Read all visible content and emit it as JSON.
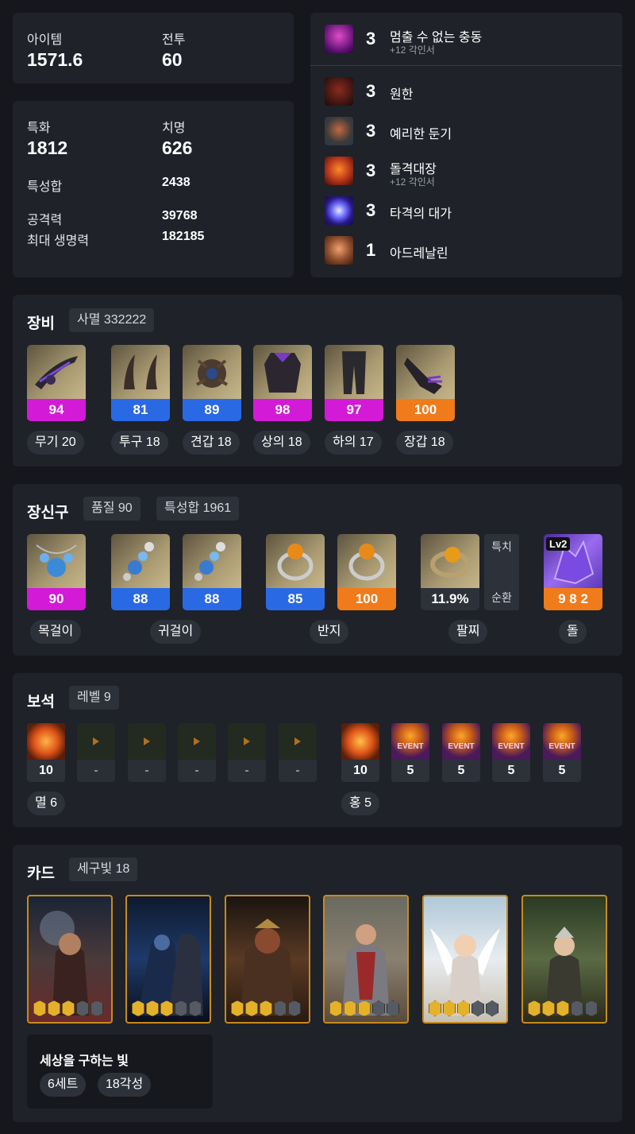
{
  "summary": {
    "item_level_label": "아이템",
    "item_level_value": "1571.6",
    "combat_level_label": "전투",
    "combat_level_value": "60"
  },
  "stats": {
    "spec_label": "특화",
    "spec_value": "1812",
    "crit_label": "치명",
    "crit_value": "626",
    "total_label": "특성합",
    "total_value": "2438",
    "attack_label": "공격력",
    "attack_value": "39768",
    "hp_label": "최대 생명력",
    "hp_value": "182185"
  },
  "engravings": [
    {
      "level": "3",
      "name": "멈출 수 없는 충동",
      "sub": "+12 각인서",
      "icon": "impulse-icon"
    },
    {
      "level": "3",
      "name": "원한",
      "sub": "",
      "icon": "grudge-icon"
    },
    {
      "level": "3",
      "name": "예리한 둔기",
      "sub": "",
      "icon": "keen-blunt-icon"
    },
    {
      "level": "3",
      "name": "돌격대장",
      "sub": "+12 각인서",
      "icon": "raid-captain-icon"
    },
    {
      "level": "3",
      "name": "타격의 대가",
      "sub": "",
      "icon": "master-brawler-icon"
    },
    {
      "level": "1",
      "name": "아드레날린",
      "sub": "",
      "icon": "adrenaline-icon"
    }
  ],
  "equipment": {
    "title": "장비",
    "set_tag": "사멸 332222",
    "items": [
      {
        "quality": "94",
        "label": "무기 20",
        "color": "#d31ad6"
      },
      {
        "quality": "81",
        "label": "투구 18",
        "color": "#2a69e4"
      },
      {
        "quality": "89",
        "label": "견갑 18",
        "color": "#2a69e4"
      },
      {
        "quality": "98",
        "label": "상의 18",
        "color": "#d31ad6"
      },
      {
        "quality": "97",
        "label": "하의 17",
        "color": "#d31ad6"
      },
      {
        "quality": "100",
        "label": "장갑 18",
        "color": "#f07b1a"
      }
    ]
  },
  "accessories": {
    "title": "장신구",
    "quality_tag": "품질 90",
    "stat_tag": "특성합 1961",
    "items": [
      {
        "quality": "90",
        "color": "#d31ad6"
      },
      {
        "quality": "88",
        "color": "#2a69e4"
      },
      {
        "quality": "88",
        "color": "#2a69e4"
      },
      {
        "quality": "85",
        "color": "#2a69e4"
      },
      {
        "quality": "100",
        "color": "#f07b1a"
      }
    ],
    "labels": {
      "necklace": "목걸이",
      "earring": "귀걸이",
      "ring": "반지",
      "bracelet": "팔찌",
      "stone": "돌"
    },
    "bracelet_value": "11.9%",
    "bracelet_effects": [
      "특치",
      "순환"
    ],
    "stone_level": "Lv2",
    "stone_value": "9 8 2"
  },
  "gems": {
    "title": "보석",
    "level_tag": "레벨 9",
    "left": [
      {
        "value": "10",
        "filled": true
      },
      {
        "value": "-",
        "filled": false
      },
      {
        "value": "-",
        "filled": false
      },
      {
        "value": "-",
        "filled": false
      },
      {
        "value": "-",
        "filled": false
      },
      {
        "value": "-",
        "filled": false
      }
    ],
    "right": [
      {
        "value": "10",
        "event": false
      },
      {
        "value": "5",
        "event": true
      },
      {
        "value": "5",
        "event": true
      },
      {
        "value": "5",
        "event": true
      },
      {
        "value": "5",
        "event": true
      }
    ],
    "event_text": "EVENT",
    "left_summary": "멸 6",
    "right_summary": "홍 5"
  },
  "cards": {
    "title": "카드",
    "set_tag": "세구빛 18",
    "awakening": [
      3,
      3,
      3,
      3,
      3,
      3
    ],
    "set_name": "세상을 구하는 빛",
    "set_count": "6세트",
    "set_awaken": "18각성"
  }
}
